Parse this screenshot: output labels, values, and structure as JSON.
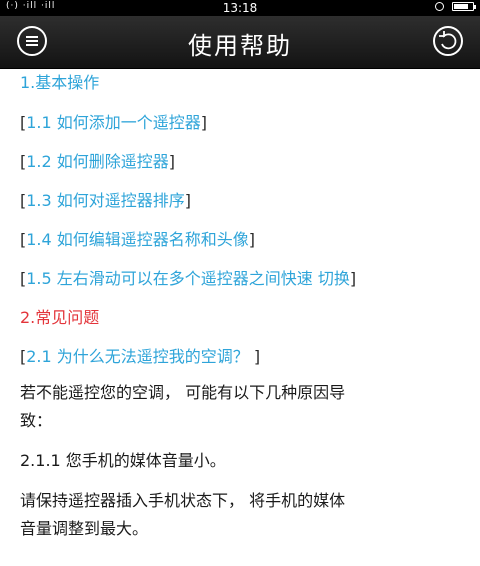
{
  "status": {
    "signal_text": "(·) ·ill ·ill",
    "time": "13:18",
    "battery_level": 0.85
  },
  "header": {
    "title": "使用帮助"
  },
  "content": {
    "section1": "1.基本操作",
    "links": [
      "1.1 如何添加一个遥控器",
      "1.2 如何删除遥控器",
      "1.3 如何对遥控器排序",
      "1.4 如何编辑遥控器名称和头像",
      "1.5 左右滑动可以在多个遥控器之间快速 切换"
    ],
    "section2": "2.常见问题",
    "q21": "2.1 为什么无法遥控我的空调？",
    "para1_line1": "若不能遥控您的空调， 可能有以下几种原因导",
    "para1_line2": "致：",
    "para2": "2.1.1 您手机的媒体音量小。",
    "para3_line1": "请保持遥控器插入手机状态下， 将手机的媒体",
    "para3_line2": "音量调整到最大。"
  },
  "colors": {
    "link": "#2ea4d9",
    "section_red": "#e3343a"
  }
}
